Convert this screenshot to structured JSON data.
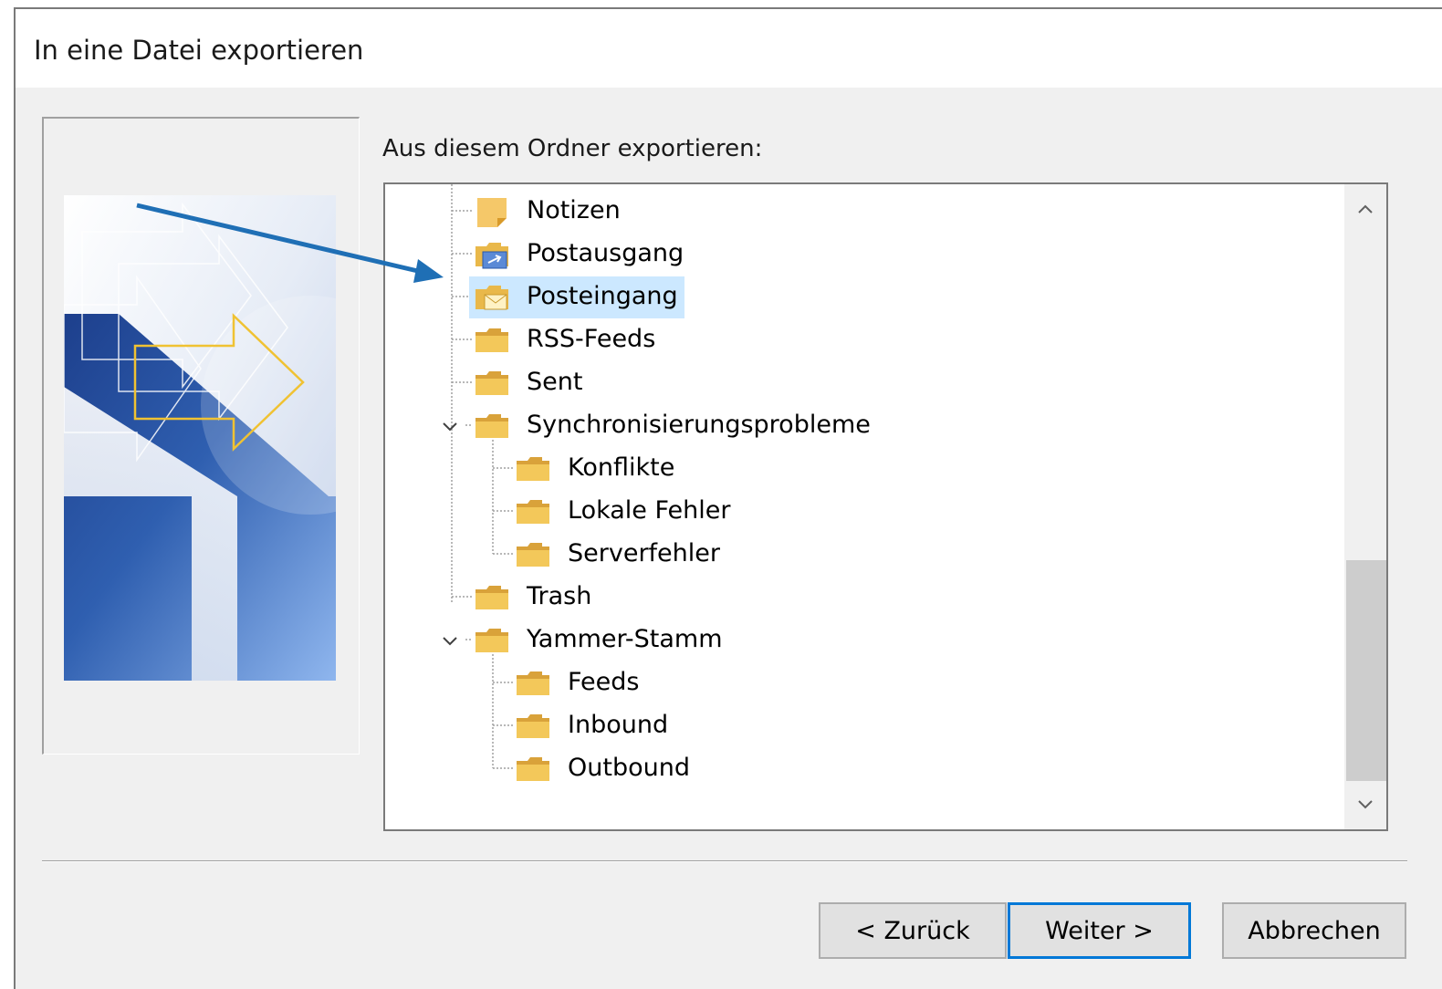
{
  "dialog": {
    "title": "In eine Datei exportieren",
    "tree_label": "Aus diesem Ordner exportieren:"
  },
  "tree": {
    "items": [
      {
        "label": "Notizen",
        "icon": "notes-icon"
      },
      {
        "label": "Postausgang",
        "icon": "outbox-folder-icon"
      },
      {
        "label": "Posteingang",
        "icon": "inbox-folder-icon",
        "selected": true
      },
      {
        "label": "RSS-Feeds",
        "icon": "folder-icon"
      },
      {
        "label": "Sent",
        "icon": "folder-icon"
      },
      {
        "label": "Synchronisierungsprobleme",
        "icon": "folder-icon",
        "expanded": true
      },
      {
        "label": "Konflikte",
        "icon": "folder-icon"
      },
      {
        "label": "Lokale Fehler",
        "icon": "folder-icon"
      },
      {
        "label": "Serverfehler",
        "icon": "folder-icon"
      },
      {
        "label": "Trash",
        "icon": "folder-icon"
      },
      {
        "label": "Yammer-Stamm",
        "icon": "folder-icon",
        "expanded": true
      },
      {
        "label": "Feeds",
        "icon": "folder-icon"
      },
      {
        "label": "Inbound",
        "icon": "folder-icon"
      },
      {
        "label": "Outbound",
        "icon": "folder-icon"
      }
    ]
  },
  "buttons": {
    "back": "< Zurück",
    "next": "Weiter >",
    "cancel": "Abbrechen"
  },
  "colors": {
    "selection": "#cce8ff",
    "accent": "#0078d7",
    "annotation_arrow": "#1f6fb5"
  }
}
